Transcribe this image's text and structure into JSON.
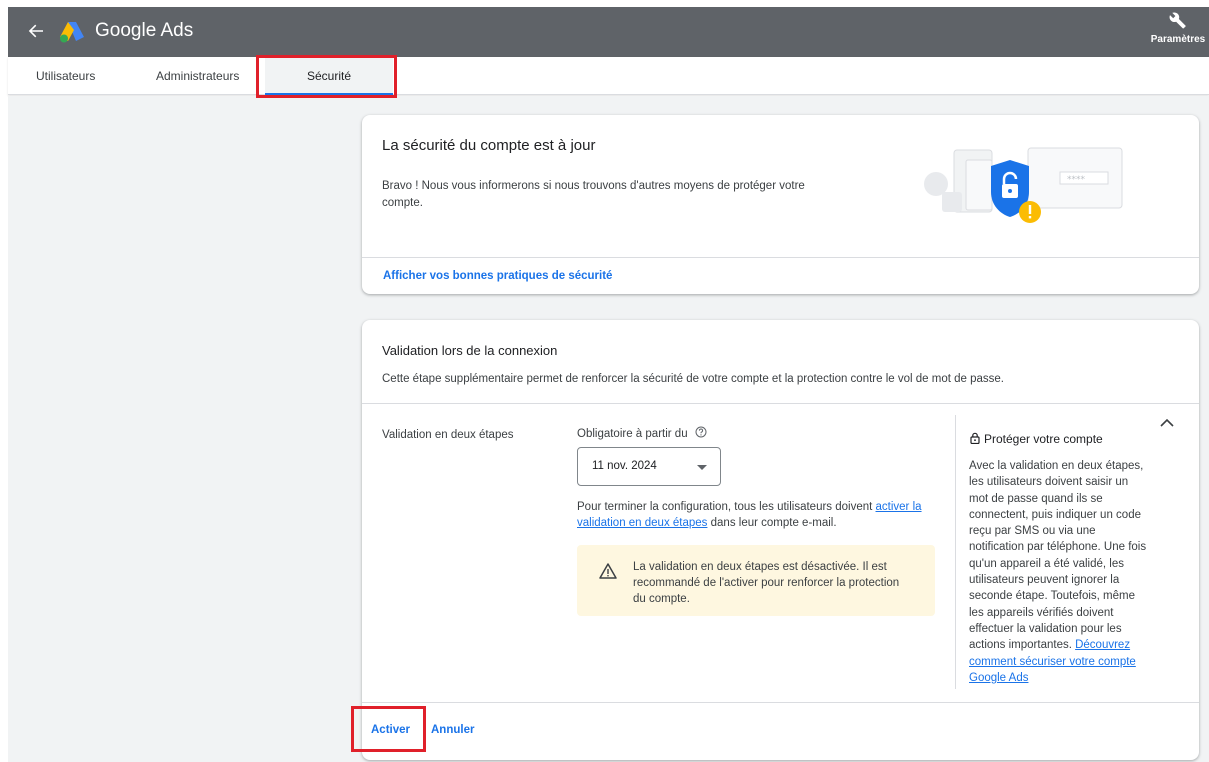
{
  "header": {
    "app_title": "Google Ads",
    "back_icon": "arrow-left-icon",
    "settings_label": "Paramètres",
    "settings_icon": "wrench-icon",
    "bar_color": "#5f6368"
  },
  "tabs": [
    {
      "label": "Utilisateurs",
      "active": false
    },
    {
      "label": "Administrateurs",
      "active": false
    },
    {
      "label": "Sécurité",
      "active": true
    }
  ],
  "security_status": {
    "title": "La sécurité du compte est à jour",
    "text": "Bravo ! Nous vous informerons si nous trouvons d'autres moyens de protéger votre compte.",
    "link": "Afficher vos bonnes pratiques de sécurité"
  },
  "login_validation": {
    "title": "Validation lors de la connexion",
    "description": "Cette étape supplémentaire permet de renforcer la sécurité de votre compte et la protection contre le vol de mot de passe.",
    "setting_label": "Validation en deux étapes",
    "required_label": "Obligatoire à partir du",
    "date_value": "11 nov. 2024",
    "config_text_before": "Pour terminer la configuration, tous les utilisateurs doivent ",
    "config_link": "activer la validation en deux étapes",
    "config_text_after": " dans leur compte e-mail.",
    "warning": "La validation en deux étapes est désactivée. Il est recommandé de l'activer pour renforcer la protection du compte.",
    "warning_color": "#fef7e0",
    "side_title": "Protéger votre compte",
    "side_text": "Avec la validation en deux étapes, les utilisateurs doivent saisir un mot de passe quand ils se connectent, puis indiquer un code reçu par SMS ou via une notification par téléphone. Une fois qu'un appareil a été validé, les utilisateurs peuvent ignorer la seconde étape. Toutefois, même les appareils vérifiés doivent effectuer la validation pour les actions importantes. ",
    "side_link": "Découvrez comment sécuriser votre compte Google Ads",
    "activate_label": "Activer",
    "cancel_label": "Annuler"
  },
  "accent_color": "#1a73e8",
  "highlight_color": "#e0202a"
}
